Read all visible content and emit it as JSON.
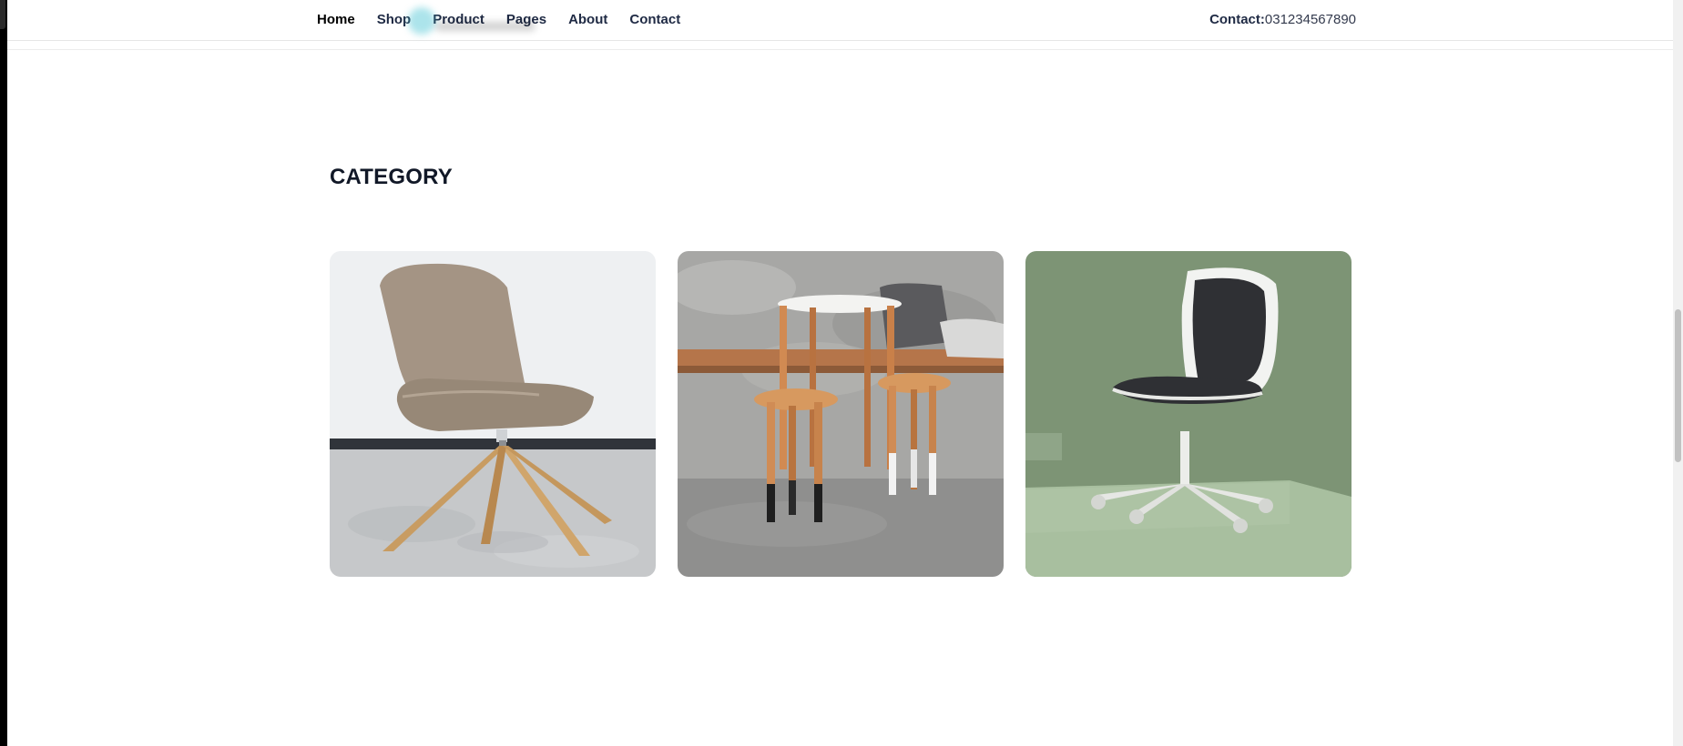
{
  "nav": {
    "items": [
      {
        "label": "Home",
        "active": true
      },
      {
        "label": "Shop",
        "active": false
      },
      {
        "label": "Product",
        "active": false
      },
      {
        "label": "Pages",
        "active": false
      },
      {
        "label": "About",
        "active": false
      },
      {
        "label": "Contact",
        "active": false
      }
    ]
  },
  "header": {
    "contact_label": "Contact:",
    "contact_phone": "031234567890"
  },
  "category": {
    "title": "CATEGORY",
    "cards": [
      {
        "image": "beige-lounge-chair-photo",
        "background": "#eef0f2"
      },
      {
        "image": "wooden-stools-and-table-photo",
        "background": "#a7a7a5"
      },
      {
        "image": "white-office-chair-photo",
        "background": "#7d9475"
      }
    ]
  },
  "colors": {
    "text_dark": "#111827",
    "nav_text": "#1f2a44"
  }
}
